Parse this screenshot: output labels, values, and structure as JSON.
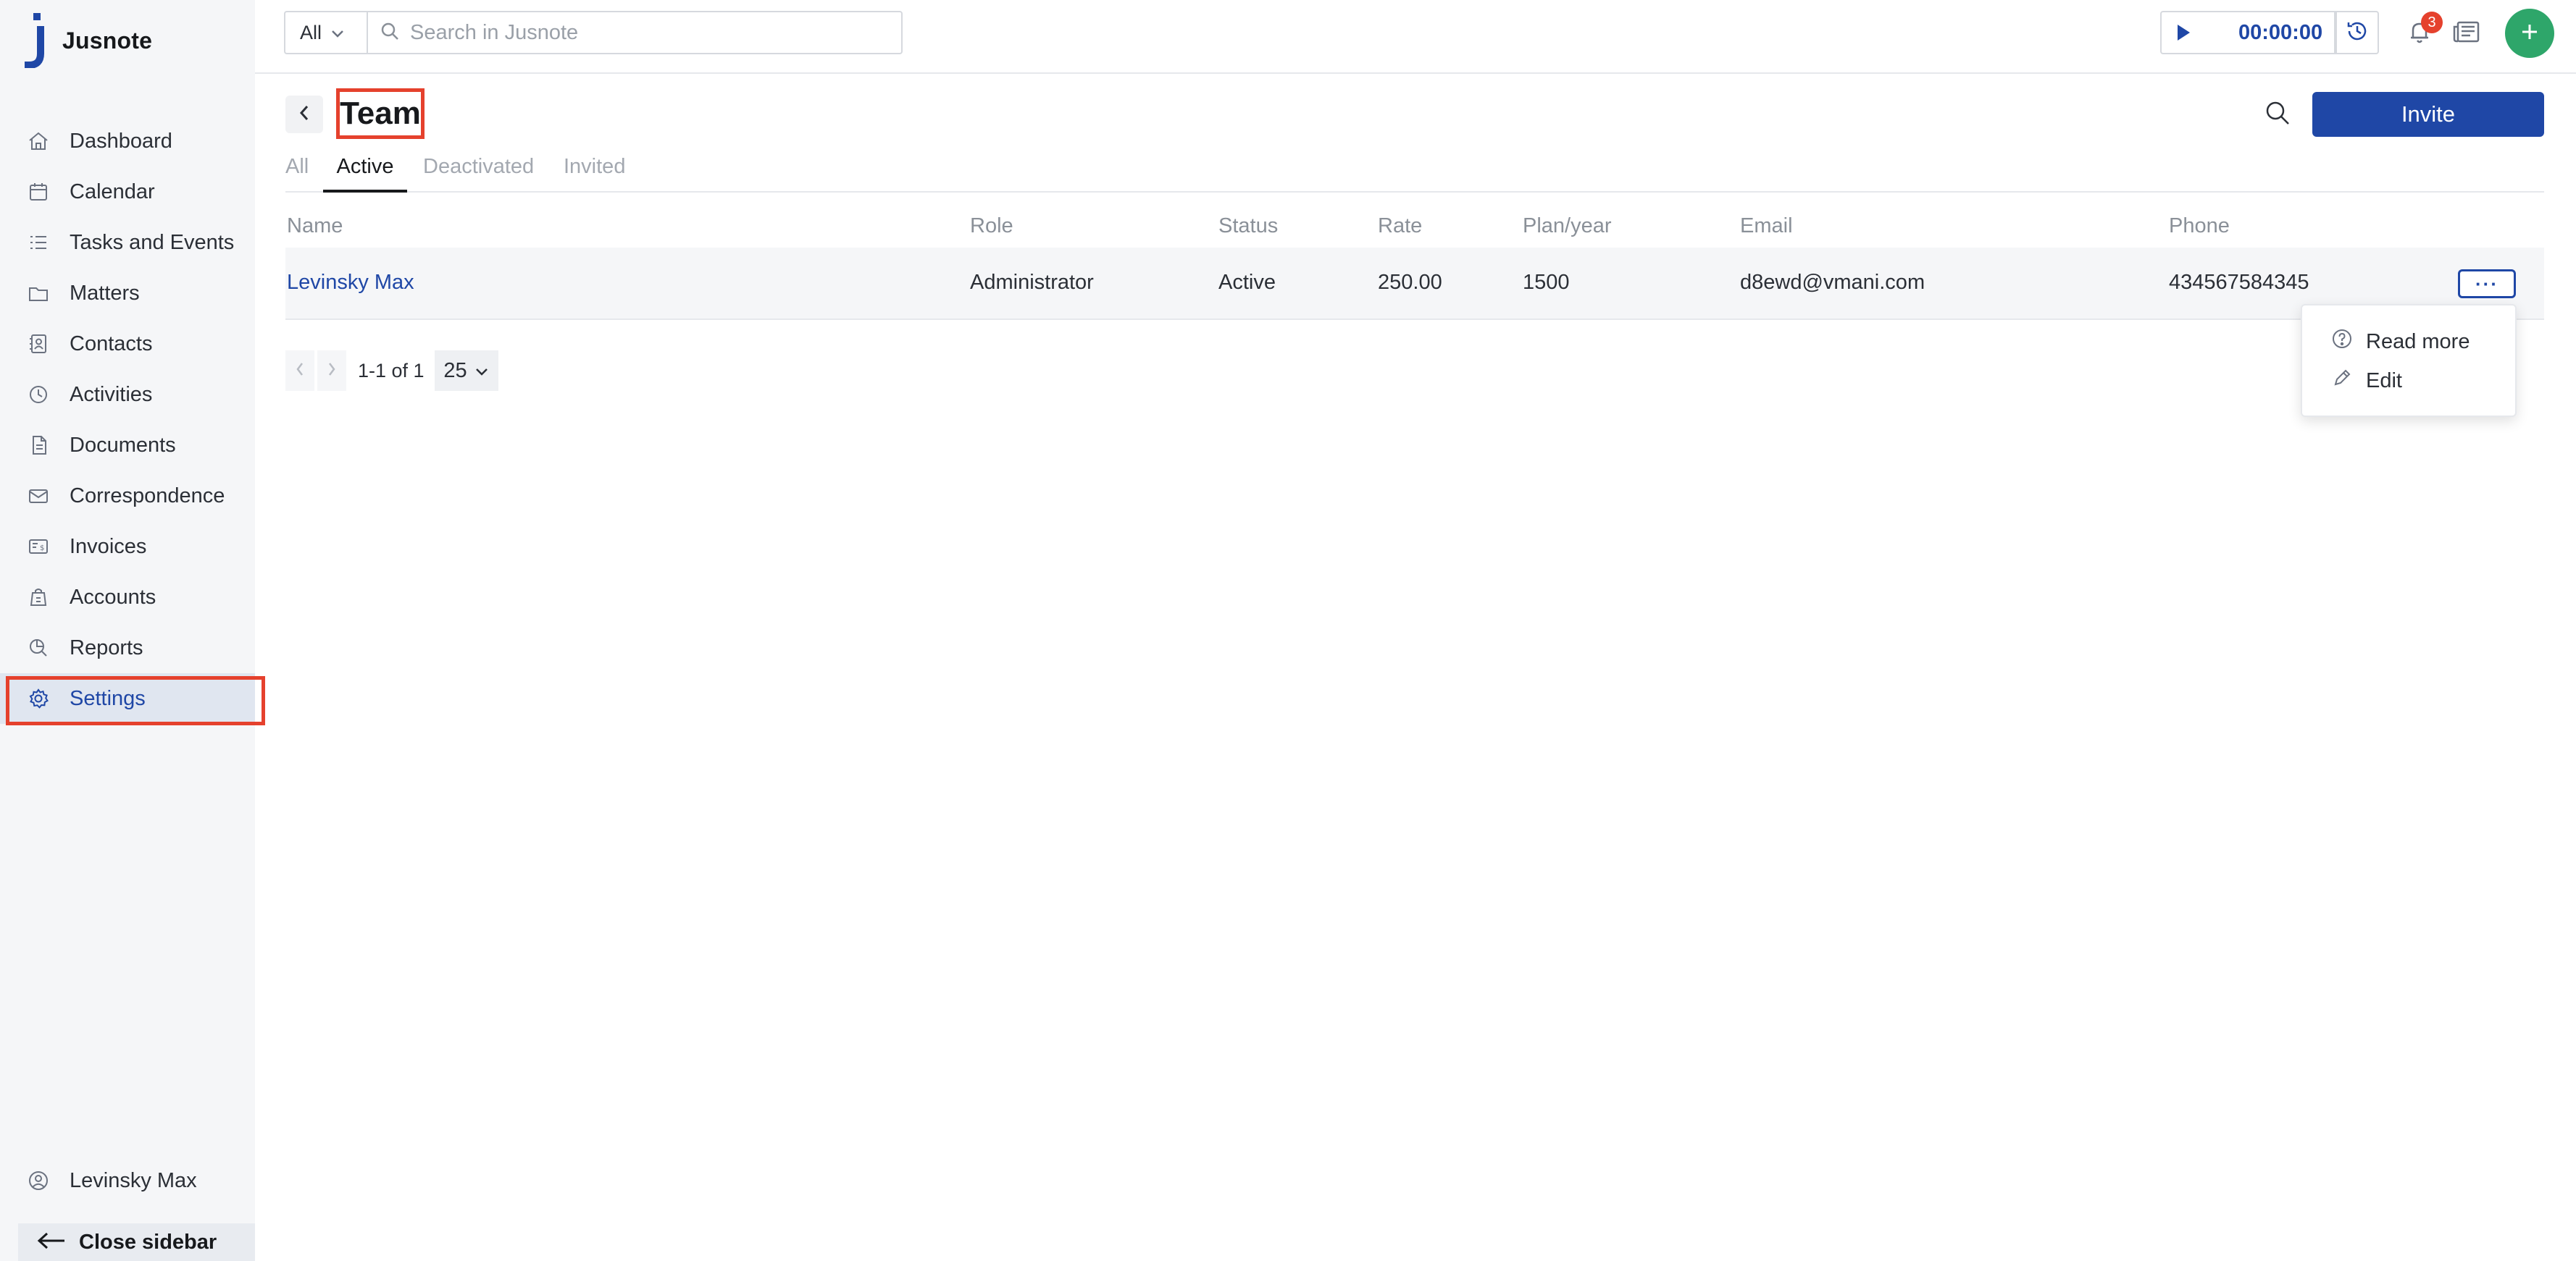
{
  "app": {
    "name": "Jusnote"
  },
  "sidebar": {
    "items": [
      {
        "label": "Dashboard",
        "icon": "home-icon"
      },
      {
        "label": "Calendar",
        "icon": "calendar-icon"
      },
      {
        "label": "Tasks and Events",
        "icon": "tasks-icon"
      },
      {
        "label": "Matters",
        "icon": "folder-icon"
      },
      {
        "label": "Contacts",
        "icon": "contacts-icon"
      },
      {
        "label": "Activities",
        "icon": "activities-icon"
      },
      {
        "label": "Documents",
        "icon": "documents-icon"
      },
      {
        "label": "Correspondence",
        "icon": "correspondence-icon"
      },
      {
        "label": "Invoices",
        "icon": "invoice-icon"
      },
      {
        "label": "Accounts",
        "icon": "accounts-icon"
      },
      {
        "label": "Reports",
        "icon": "reports-icon"
      },
      {
        "label": "Settings",
        "icon": "gear-icon",
        "active": true
      }
    ],
    "user": {
      "name": "Levinsky Max"
    },
    "close_label": "Close sidebar"
  },
  "topbar": {
    "filter_value": "All",
    "search_placeholder": "Search in Jusnote",
    "timer_value": "00:00:00",
    "notifications_count": "3"
  },
  "page": {
    "title": "Team",
    "invite_label": "Invite",
    "tabs": [
      {
        "label": "All"
      },
      {
        "label": "Active",
        "active": true
      },
      {
        "label": "Deactivated"
      },
      {
        "label": "Invited"
      }
    ]
  },
  "table": {
    "headers": {
      "name": "Name",
      "role": "Role",
      "status": "Status",
      "rate": "Rate",
      "plan": "Plan/year",
      "email": "Email",
      "phone": "Phone"
    },
    "rows": [
      {
        "name": "Levinsky Max",
        "role": "Administrator",
        "status": "Active",
        "rate": "250.00",
        "plan": "1500",
        "email": "d8ewd@vmani.com",
        "phone": "434567584345",
        "menu_label": "···"
      }
    ]
  },
  "pagination": {
    "range_text": "1-1 of 1",
    "page_size": "25"
  },
  "row_menu": {
    "items": [
      {
        "label": "Read more",
        "icon": "question-circle-icon"
      },
      {
        "label": "Edit",
        "icon": "pencil-icon"
      }
    ]
  },
  "colors": {
    "brand_blue": "#1f47a6",
    "highlight_red": "#e5412d",
    "add_green": "#2ea66a"
  }
}
